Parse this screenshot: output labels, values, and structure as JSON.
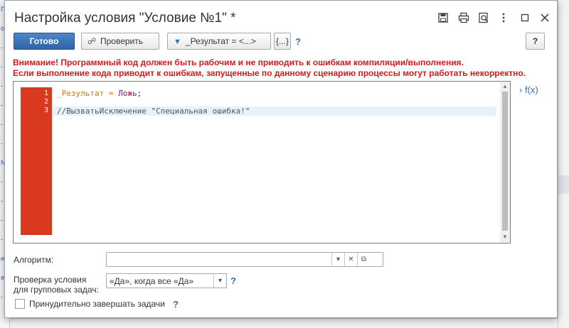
{
  "background": {
    "left_fragments": [
      "Г",
      "о",
      "-",
      "-",
      "-",
      "-",
      "-",
      "-",
      "№",
      "-",
      "-",
      "-",
      "-",
      "и",
      "я",
      "-"
    ]
  },
  "window": {
    "title": "Настройка условия \"Условие №1\" *"
  },
  "toolbar": {
    "done_label": "Готово",
    "check_label": "Проверить",
    "result_label": "_Результат = <...>",
    "braces_label": "{...}",
    "help_q": "?",
    "help_button": "?"
  },
  "warning": {
    "line1": "Внимание! Программный код должен быть рабочим и не приводить к ошибкам компиляции/выполнения.",
    "line2": "Если выполнение кода приводит к ошибкам, запущенные по данному сценарию процессы могут работать некорректно."
  },
  "editor": {
    "line_numbers": [
      "1",
      "2",
      "3"
    ],
    "line1": {
      "var": "_Результат",
      "op": " = ",
      "value": "Ложь",
      "end": ";"
    },
    "line3": "//ВызватьИсключение \"Специальная ошибка!\""
  },
  "fx_label": "f(x)",
  "form": {
    "algorithm_label": "Алгоритм:",
    "algorithm_value": "",
    "check_label_line1": "Проверка условия",
    "check_label_line2": "для групповых задач:",
    "check_value": "«Да», когда все «Да»",
    "check_help": "?",
    "force_label": "Принудительно завершать задачи",
    "force_help": "?",
    "force_checked": false
  },
  "colors": {
    "warning": "#d4191d",
    "accent": "#2b6fc0",
    "gutter": "#d93a1f",
    "keyword_var": "#c77a1c",
    "keyword_value": "#9c1060",
    "comment": "#555555"
  }
}
